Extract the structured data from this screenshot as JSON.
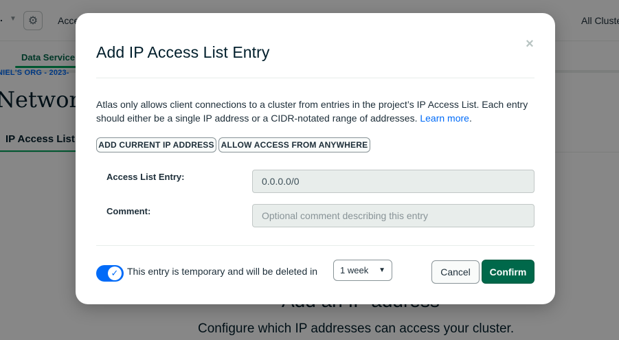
{
  "background": {
    "org_selector": ".",
    "access_label": "Acce",
    "all_clusters": "All Cluste",
    "data_services_tab": "Data Service",
    "breadcrumb": "NIEL'S ORG - 2023-",
    "page_title": "Network",
    "active_tab": "IP Access List",
    "empty_state_title": "Add an IP address",
    "empty_state_subtitle": "Configure which IP addresses can access your cluster."
  },
  "modal": {
    "title": "Add IP Access List Entry",
    "close_icon": "close-icon",
    "description": "Atlas only allows client connections to a cluster from entries in the project’s IP Access List. Each entry should either be a single IP address or a CIDR-notated range of addresses.",
    "learn_more": "Learn more",
    "description_end": ".",
    "add_current_ip_button": "ADD CURRENT IP ADDRESS",
    "allow_anywhere_button": "ALLOW ACCESS FROM ANYWHERE",
    "access_list_entry_label": "Access List Entry:",
    "access_list_entry_value": "0.0.0.0/0",
    "comment_label": "Comment:",
    "comment_placeholder": "Optional comment describing this entry",
    "temporary_toggle_on": true,
    "temporary_text": "This entry is temporary and will be deleted in",
    "duration_selected": "1 week",
    "cancel_button": "Cancel",
    "confirm_button": "Confirm"
  },
  "colors": {
    "overlay": "#000000",
    "accent_blue": "#016bf8",
    "confirm_green": "#00684a",
    "brand_green": "#00a35c"
  }
}
